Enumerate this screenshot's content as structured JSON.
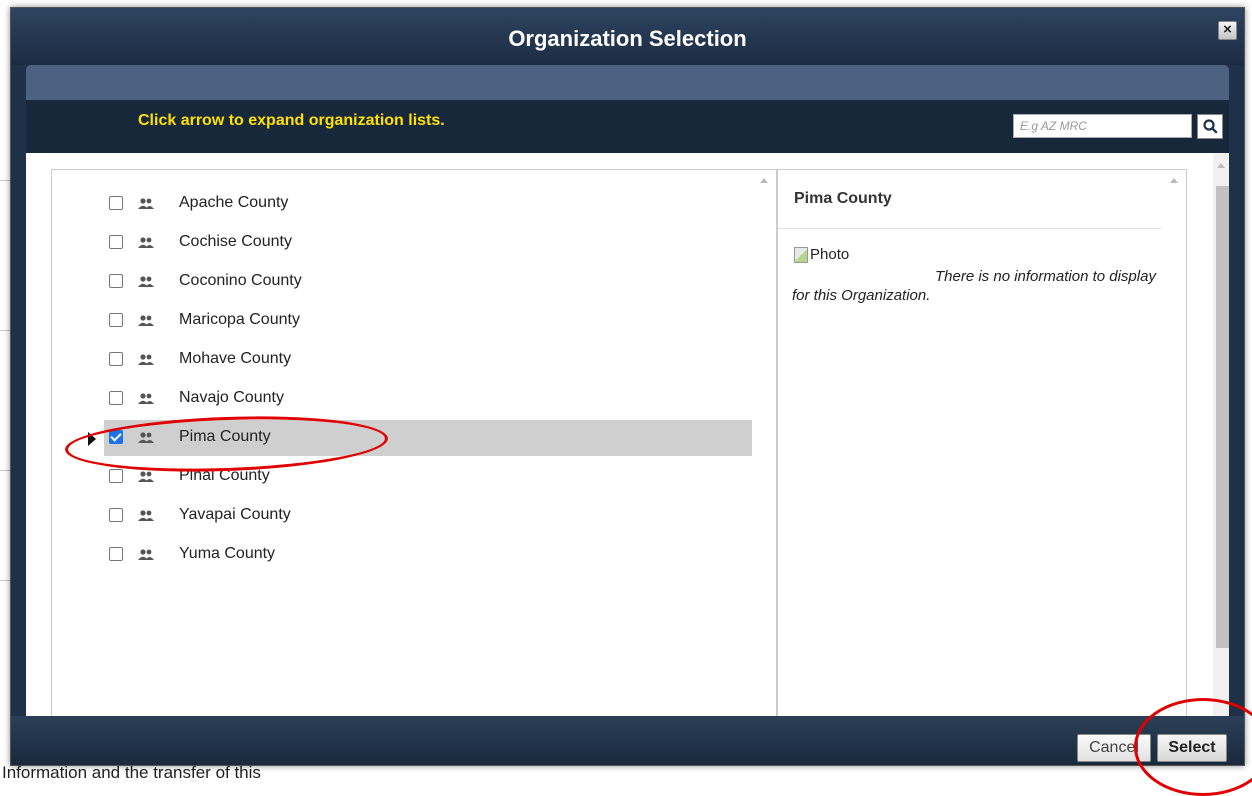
{
  "background": {
    "partial_text": "Information and the transfer of this"
  },
  "dialog": {
    "title": "Organization Selection",
    "close_label": "×",
    "hint": "Click arrow to expand organization lists.",
    "search": {
      "placeholder": "E.g AZ MRC",
      "value": ""
    },
    "organizations": [
      {
        "name": "Apache County",
        "checked": false
      },
      {
        "name": "Cochise County",
        "checked": false
      },
      {
        "name": "Coconino County",
        "checked": false
      },
      {
        "name": "Maricopa County",
        "checked": false
      },
      {
        "name": "Mohave County",
        "checked": false
      },
      {
        "name": "Navajo County",
        "checked": false
      },
      {
        "name": "Pima County",
        "checked": true
      },
      {
        "name": "Pinal County",
        "checked": false
      },
      {
        "name": "Yavapai County",
        "checked": false
      },
      {
        "name": "Yuma County",
        "checked": false
      }
    ],
    "details": {
      "title": "Pima County",
      "photo_alt": "Photo",
      "info": "There is no information to display for this Organization."
    },
    "buttons": {
      "cancel": "Cancel",
      "select": "Select"
    },
    "colors": {
      "accent_highlight": "#ffe100",
      "annotation": "#e00000",
      "selected_row": "#cfcfcf"
    },
    "icons": {
      "org": "people-icon",
      "search": "search-icon",
      "expand": "expand-arrow-icon"
    }
  }
}
